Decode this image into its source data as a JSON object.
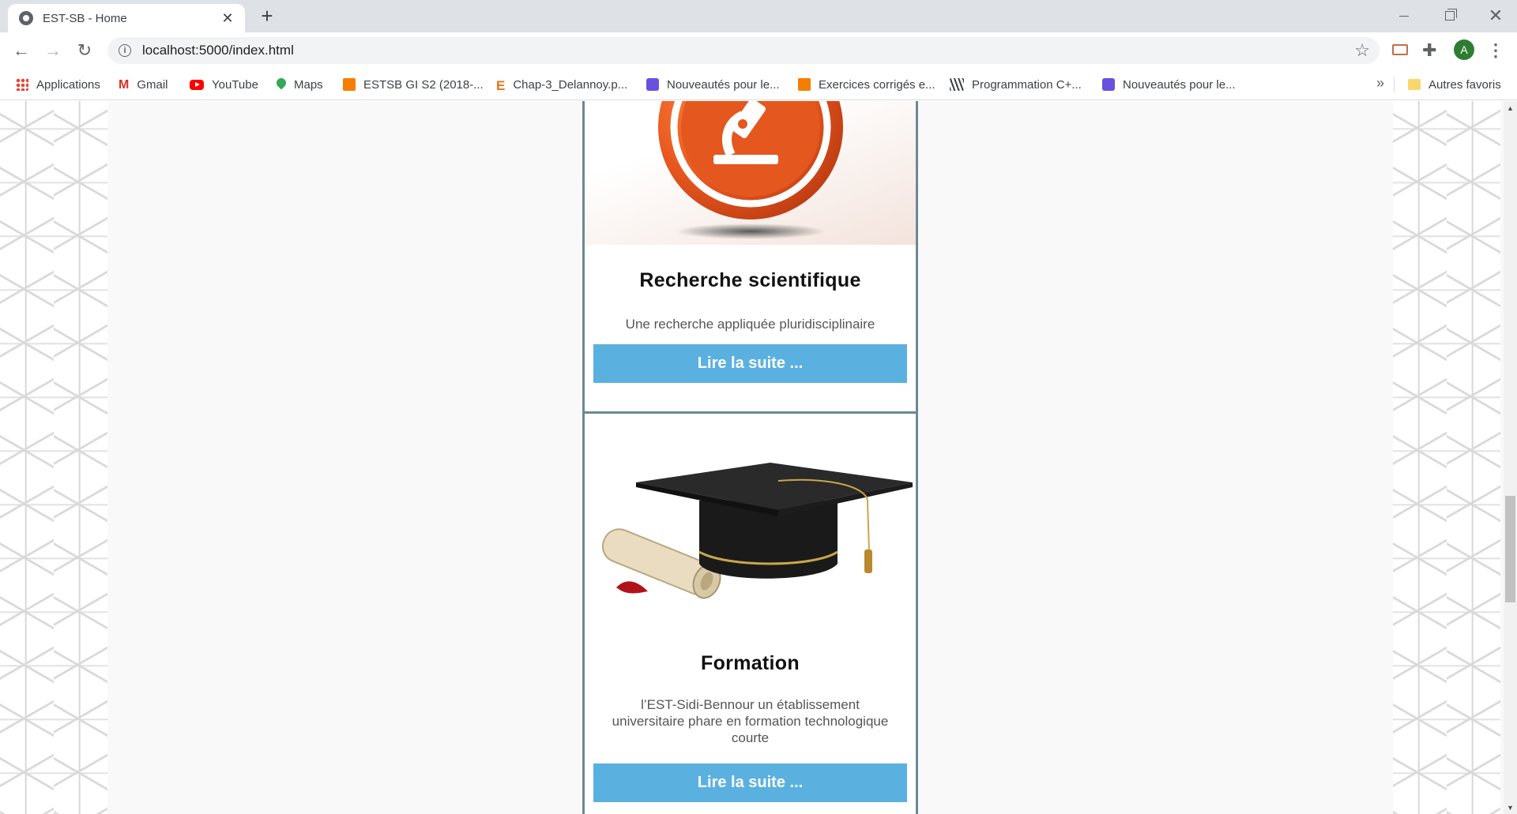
{
  "browser": {
    "tab_title": "EST-SB - Home",
    "tab_close": "✕",
    "new_tab": "+",
    "url": "localhost:5000/index.html",
    "avatar_letter": "A"
  },
  "bookmarks": [
    {
      "label": "Applications",
      "icon": "apps-grid-icon"
    },
    {
      "label": "Gmail",
      "icon": "gmail-icon"
    },
    {
      "label": "YouTube",
      "icon": "youtube-icon"
    },
    {
      "label": "Maps",
      "icon": "maps-icon"
    },
    {
      "label": "ESTSB GI S2 (2018-...",
      "icon": "blogger-icon"
    },
    {
      "label": "Chap-3_Delannoy.p...",
      "icon": "e-doc-icon"
    },
    {
      "label": "Nouveautés pour le...",
      "icon": "purple-bookmark-icon"
    },
    {
      "label": "Exercices corrigés e...",
      "icon": "blogger-icon"
    },
    {
      "label": "Programmation C+...",
      "icon": "prog-icon"
    },
    {
      "label": "Nouveautés pour le...",
      "icon": "purple-bookmark-icon"
    }
  ],
  "bookmarks_more": "»",
  "other_bookmarks": "Autres favoris",
  "cards": {
    "research": {
      "title": "Recherche scientifique",
      "description": "Une recherche appliquée pluridisciplinaire",
      "button": "Lire la suite ..."
    },
    "formation": {
      "title": "Formation",
      "description": "l’EST-Sidi-Bennour un établissement universitaire phare en formation technologique courte",
      "button": "Lire la suite ..."
    }
  },
  "colors": {
    "button": "#5ab1e0",
    "card_border": "#6f8795",
    "accent_orange": "#e8561f"
  }
}
